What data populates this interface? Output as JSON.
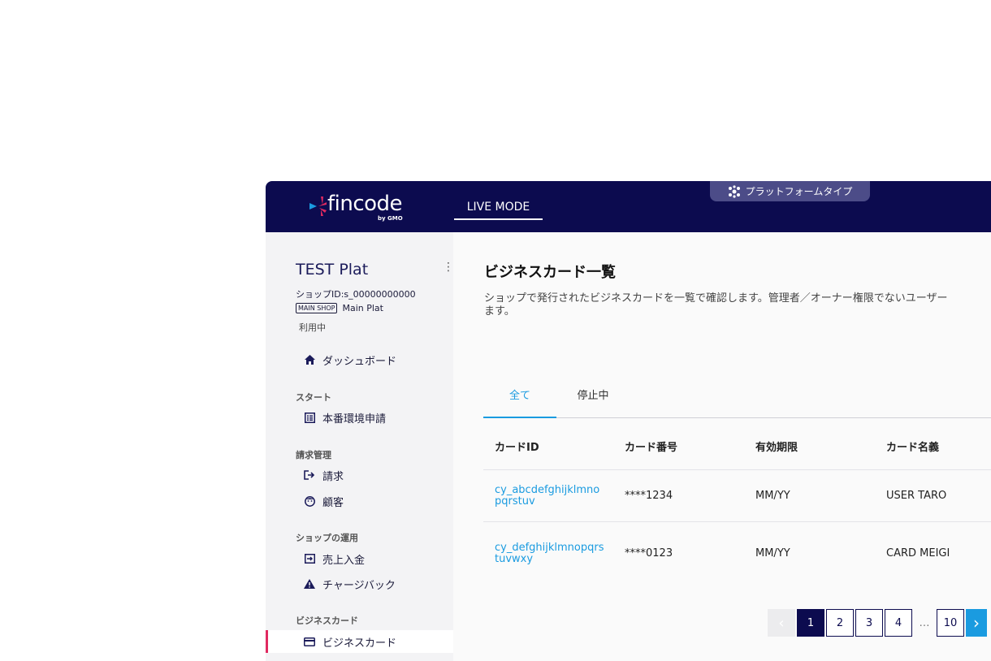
{
  "header": {
    "logo_text": "fincode",
    "logo_sub": "by GMO",
    "mode": "LIVE MODE",
    "platform_badge": "プラットフォームタイプ"
  },
  "sidebar": {
    "shop_name": "TEST Plat",
    "shop_id": "ショップID:s_00000000000",
    "main_shop_tag": "MAIN SHOP",
    "main_shop_name": "Main Plat",
    "status": "利用中",
    "dashboard": "ダッシュボード",
    "sections": {
      "start": "スタート",
      "billing": "請求管理",
      "operations": "ショップの運用",
      "business_card": "ビジネスカード"
    },
    "items": {
      "production_apply": "本番環境申請",
      "invoice": "請求",
      "customer": "顧客",
      "sales_deposit": "売上入金",
      "chargeback": "チャージバック",
      "business_card": "ビジネスカード"
    }
  },
  "main": {
    "title": "ビジネスカード一覧",
    "desc_line1": "ショップで発行されたビジネスカードを一覧で確認します。管理者／オーナー権限でないユーザー",
    "desc_line2": "ます。",
    "tabs": [
      "全て",
      "停止中"
    ],
    "columns": [
      "カードID",
      "カード番号",
      "有効期限",
      "カード名義"
    ],
    "rows": [
      {
        "card_id": "cy_abcdefghijklmnopqrstuv",
        "number": "****1234",
        "expiry": "MM/YY",
        "holder": "USER TARO"
      },
      {
        "card_id": "cy_defghijklmnopqrstuvwxy",
        "number": "****0123",
        "expiry": "MM/YY",
        "holder": "CARD MEIGI"
      }
    ],
    "pagination": {
      "pages": [
        "1",
        "2",
        "3",
        "4"
      ],
      "ellipsis": "…",
      "last": "10",
      "current": "1",
      "prev": "‹",
      "next": "›"
    }
  },
  "colors": {
    "header_bg": "#0c0b4f",
    "accent": "#1a9be0",
    "active_marker": "#e02a60"
  }
}
